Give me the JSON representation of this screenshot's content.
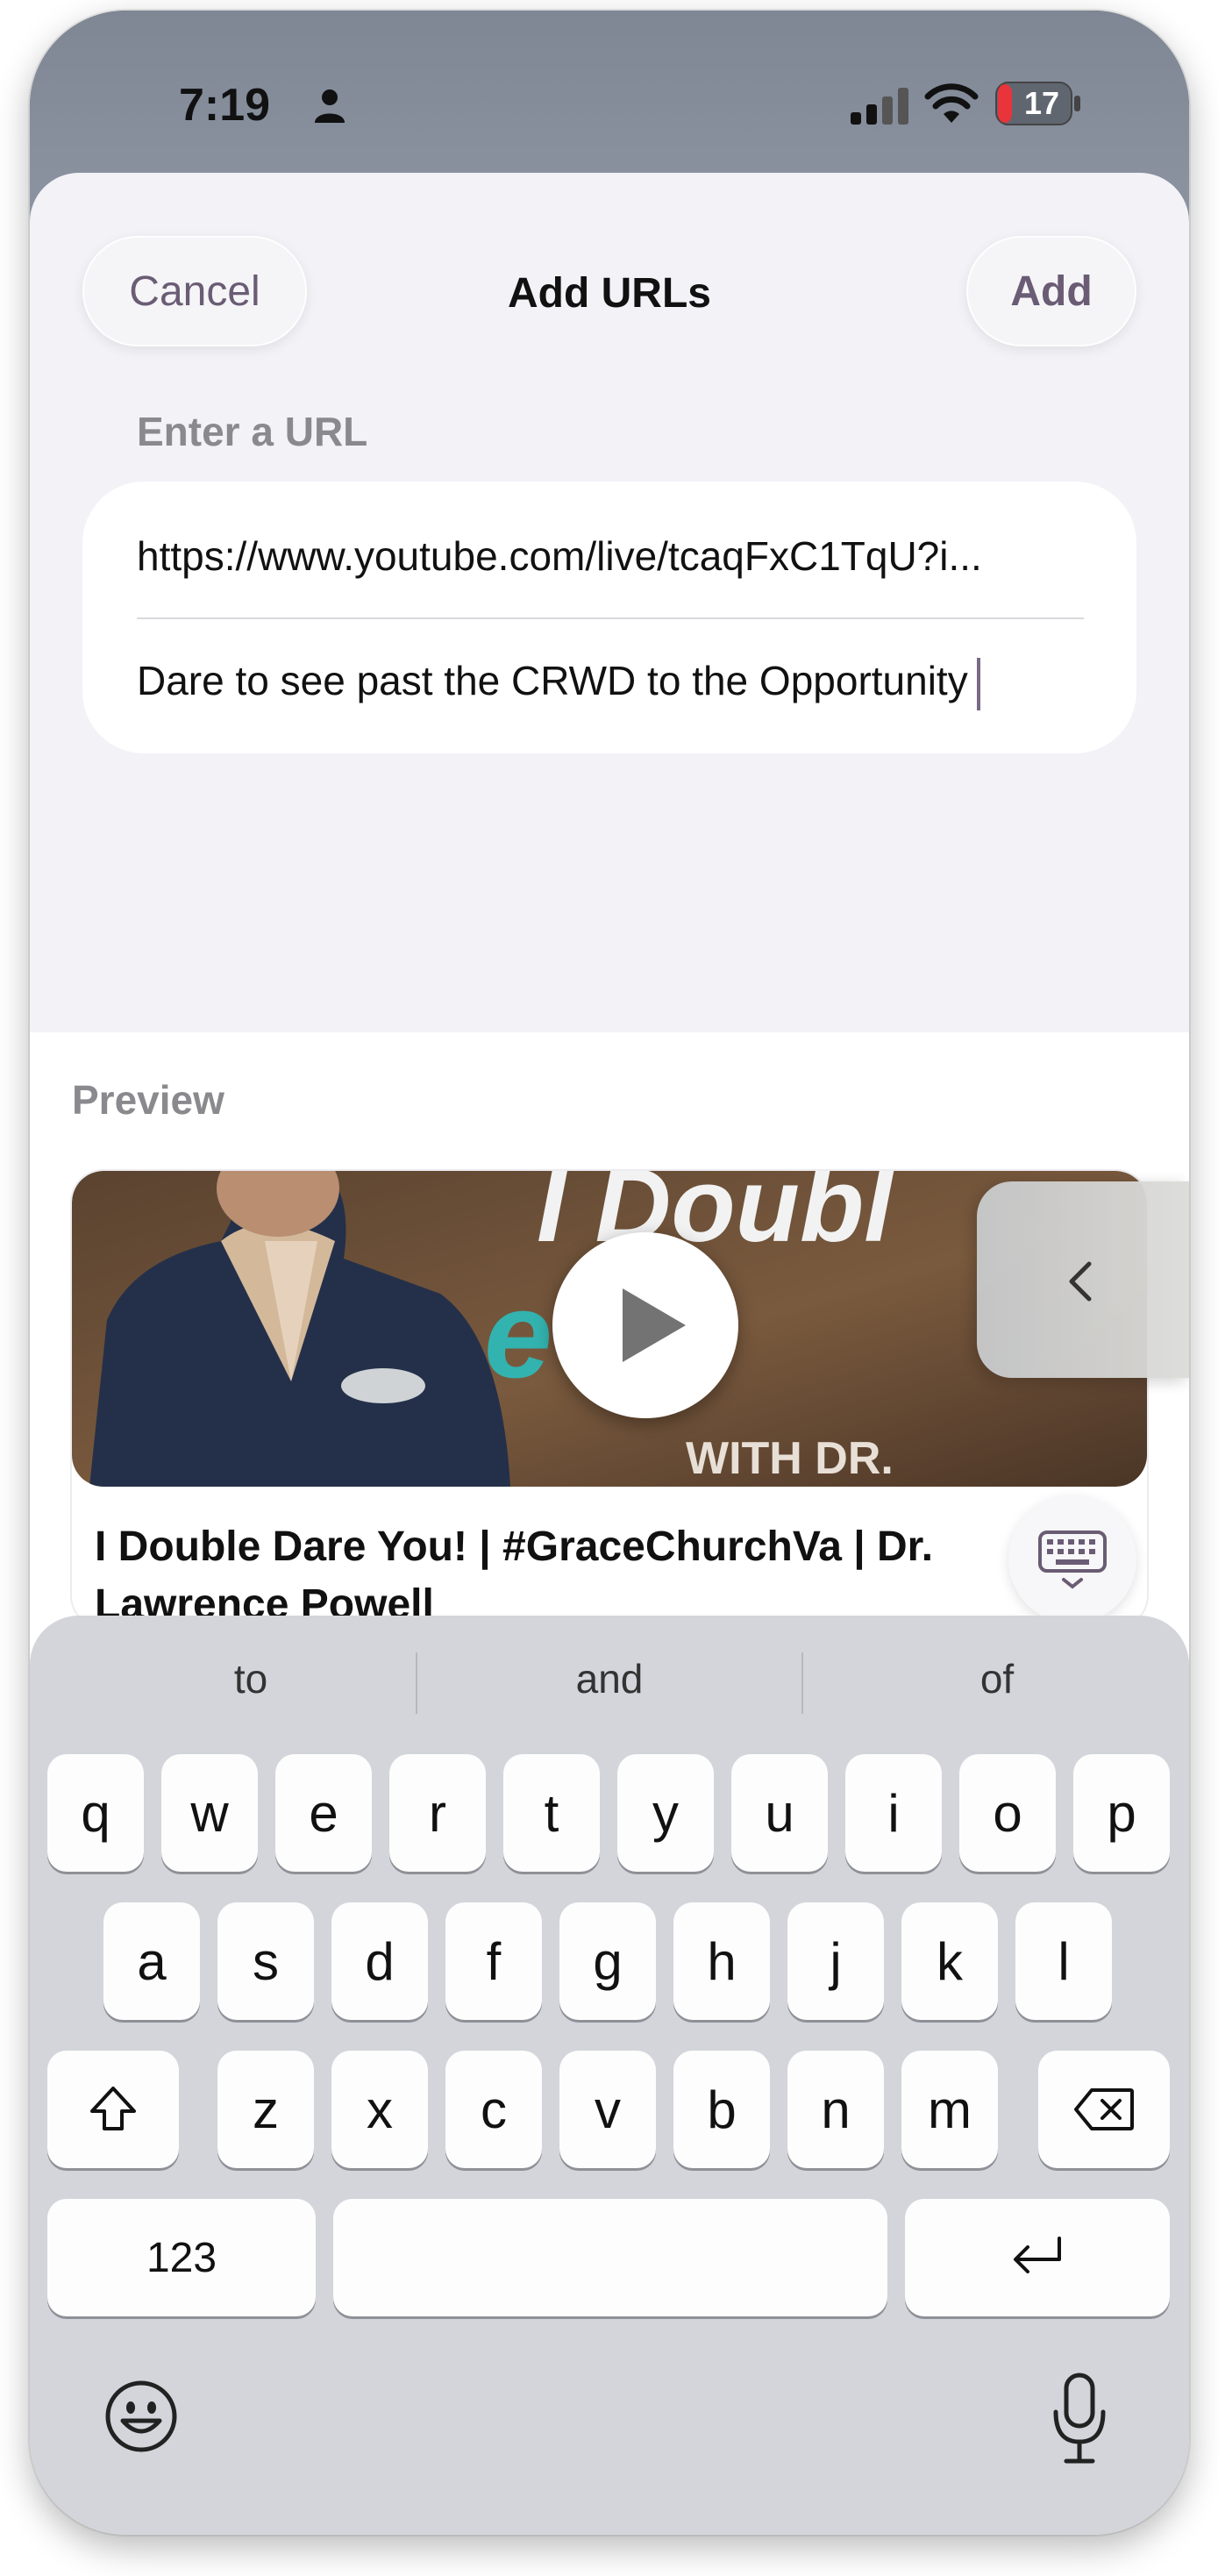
{
  "status_bar": {
    "time": "7:19",
    "battery_level": "17",
    "icons": [
      "person-icon",
      "signal-icon",
      "wifi-icon",
      "battery-icon"
    ]
  },
  "sheet": {
    "cancel_label": "Cancel",
    "title": "Add URLs",
    "add_label": "Add",
    "field_label": "Enter a URL",
    "url_value": "https://www.youtube.com/live/tcaqFxC1TqU?i...",
    "title_value": "Dare to see past the CRWD to the Opportunity"
  },
  "preview": {
    "label": "Preview",
    "thumbnail_text_line1": "I Doubl",
    "thumbnail_text_line2": "e Yo",
    "thumbnail_text_line3": "WITH DR.",
    "video_title": "I Double Dare You! | #GraceChurchVa | Dr. Lawrence Powell"
  },
  "keyboard": {
    "suggestions": [
      "to",
      "and",
      "of"
    ],
    "row1": [
      "q",
      "w",
      "e",
      "r",
      "t",
      "y",
      "u",
      "i",
      "o",
      "p"
    ],
    "row2": [
      "a",
      "s",
      "d",
      "f",
      "g",
      "h",
      "j",
      "k",
      "l"
    ],
    "row3": [
      "z",
      "x",
      "c",
      "v",
      "b",
      "n",
      "m"
    ],
    "numbers_label": "123",
    "colors": {
      "background": "#d3d5db",
      "key": "#fdfdfd"
    }
  },
  "colors": {
    "accent": "#6a5c74",
    "sheet_bg": "#f2f2f7",
    "battery_red": "#e8343a"
  }
}
